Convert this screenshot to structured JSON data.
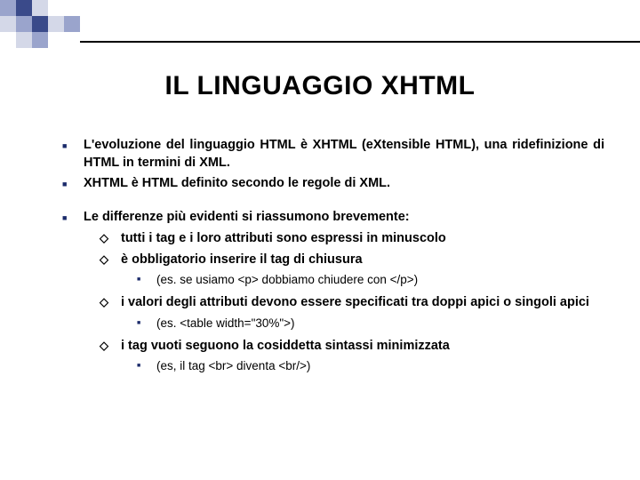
{
  "title": "IL LINGUAGGIO XHTML",
  "bullets": {
    "p1": "L'evoluzione del linguaggio HTML è XHTML (eXtensible HTML), una ridefinizione di HTML in termini di XML.",
    "p2": "XHTML è HTML definito secondo le regole di XML.",
    "p3": "Le differenze più evidenti si riassumono brevemente:",
    "p3a": "tutti i tag e i loro attributi sono espressi in minuscolo",
    "p3b": "è obbligatorio inserire il tag di chiusura",
    "p3b1": "(es. se usiamo <p> dobbiamo chiudere con </p>)",
    "p3c": "i valori degli attributi devono essere specificati tra doppi apici o singoli apici",
    "p3c1": "(es. <table width=\"30%\">)",
    "p3d": "i tag vuoti seguono la cosiddetta sintassi minimizzata",
    "p3d1": "(es, il tag <br> diventa <br/>)"
  }
}
